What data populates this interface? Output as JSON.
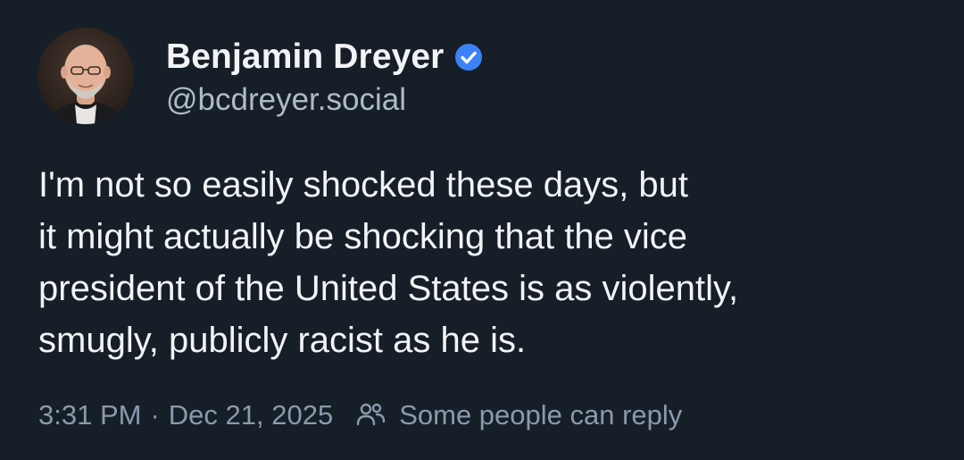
{
  "author": {
    "display_name": "Benjamin Dreyer",
    "handle": "@bcdreyer.social",
    "verified": true,
    "verified_color": "#3b82f6"
  },
  "post": {
    "text_lines": [
      "I'm not so easily shocked these days, but",
      "it might actually be shocking that the vice",
      "president of the United States is as violently,",
      "smugly, publicly racist as he is."
    ]
  },
  "meta": {
    "time": "3:31 PM",
    "separator": "·",
    "date": "Dec 21, 2025",
    "reply_icon": "people-icon",
    "reply_setting": "Some people can reply"
  },
  "colors": {
    "background": "#161e27",
    "text": "#f1f3f5",
    "muted": "#8a9aac",
    "handle": "#aebbc9"
  }
}
